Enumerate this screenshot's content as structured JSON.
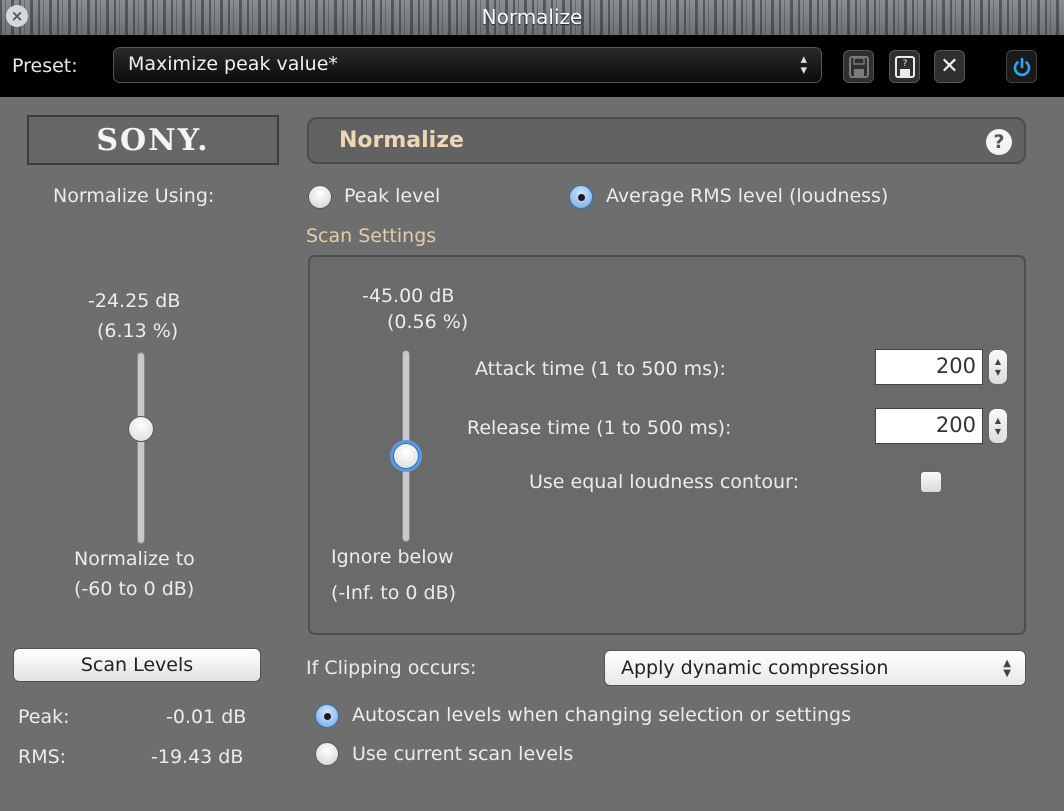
{
  "window": {
    "title": "Normalize",
    "close_icon": "close-circle-icon"
  },
  "preset": {
    "label": "Preset:",
    "selected": "Maximize peak value*",
    "buttons": {
      "save": "floppy-disk-icon",
      "save_as": "floppy-disk-question-icon",
      "delete": "✕",
      "bypass": "power-icon"
    }
  },
  "brand": {
    "logo_text": "SONY."
  },
  "header": {
    "title": "Normalize",
    "help": "?"
  },
  "normalize_using": {
    "label": "Normalize Using:",
    "options": [
      {
        "label": "Peak level",
        "selected": false
      },
      {
        "label": "Average RMS level  (loudness)",
        "selected": true
      }
    ]
  },
  "normalize_to": {
    "value_db": "-24.25 dB",
    "value_pct": "(6.13 %)",
    "label_line1": "Normalize to",
    "label_line2": "(-60 to 0 dB)",
    "level_fraction": 0.6
  },
  "scan_settings": {
    "label": "Scan Settings",
    "ignore_below": {
      "value_db": "-45.00 dB",
      "value_pct": "(0.56 %)",
      "label_line1": "Ignore below",
      "label_line2": "(-Inf. to 0 dB)",
      "level_fraction": 0.45
    },
    "attack": {
      "label": "Attack time (1 to 500 ms):",
      "value": "200"
    },
    "release": {
      "label": "Release time (1 to 500 ms):",
      "value": "200"
    },
    "equal_loudness": {
      "label": "Use equal loudness contour:",
      "checked": false
    }
  },
  "scan_levels": {
    "button": "Scan Levels",
    "peak_label": "Peak:",
    "peak_value": "-0.01 dB",
    "rms_label": "RMS:",
    "rms_value": "-19.43 dB"
  },
  "clipping": {
    "label": "If Clipping occurs:",
    "selected": "Apply dynamic compression"
  },
  "scan_mode": {
    "options": [
      {
        "label": "Autoscan levels when changing selection or settings",
        "selected": true
      },
      {
        "label": "Use current scan levels",
        "selected": false
      }
    ]
  },
  "colors": {
    "accent_blue": "#2aa7f0",
    "header_title": "#f0d7b4",
    "section_label": "#e5cba7",
    "background": "#6e6e6e"
  }
}
